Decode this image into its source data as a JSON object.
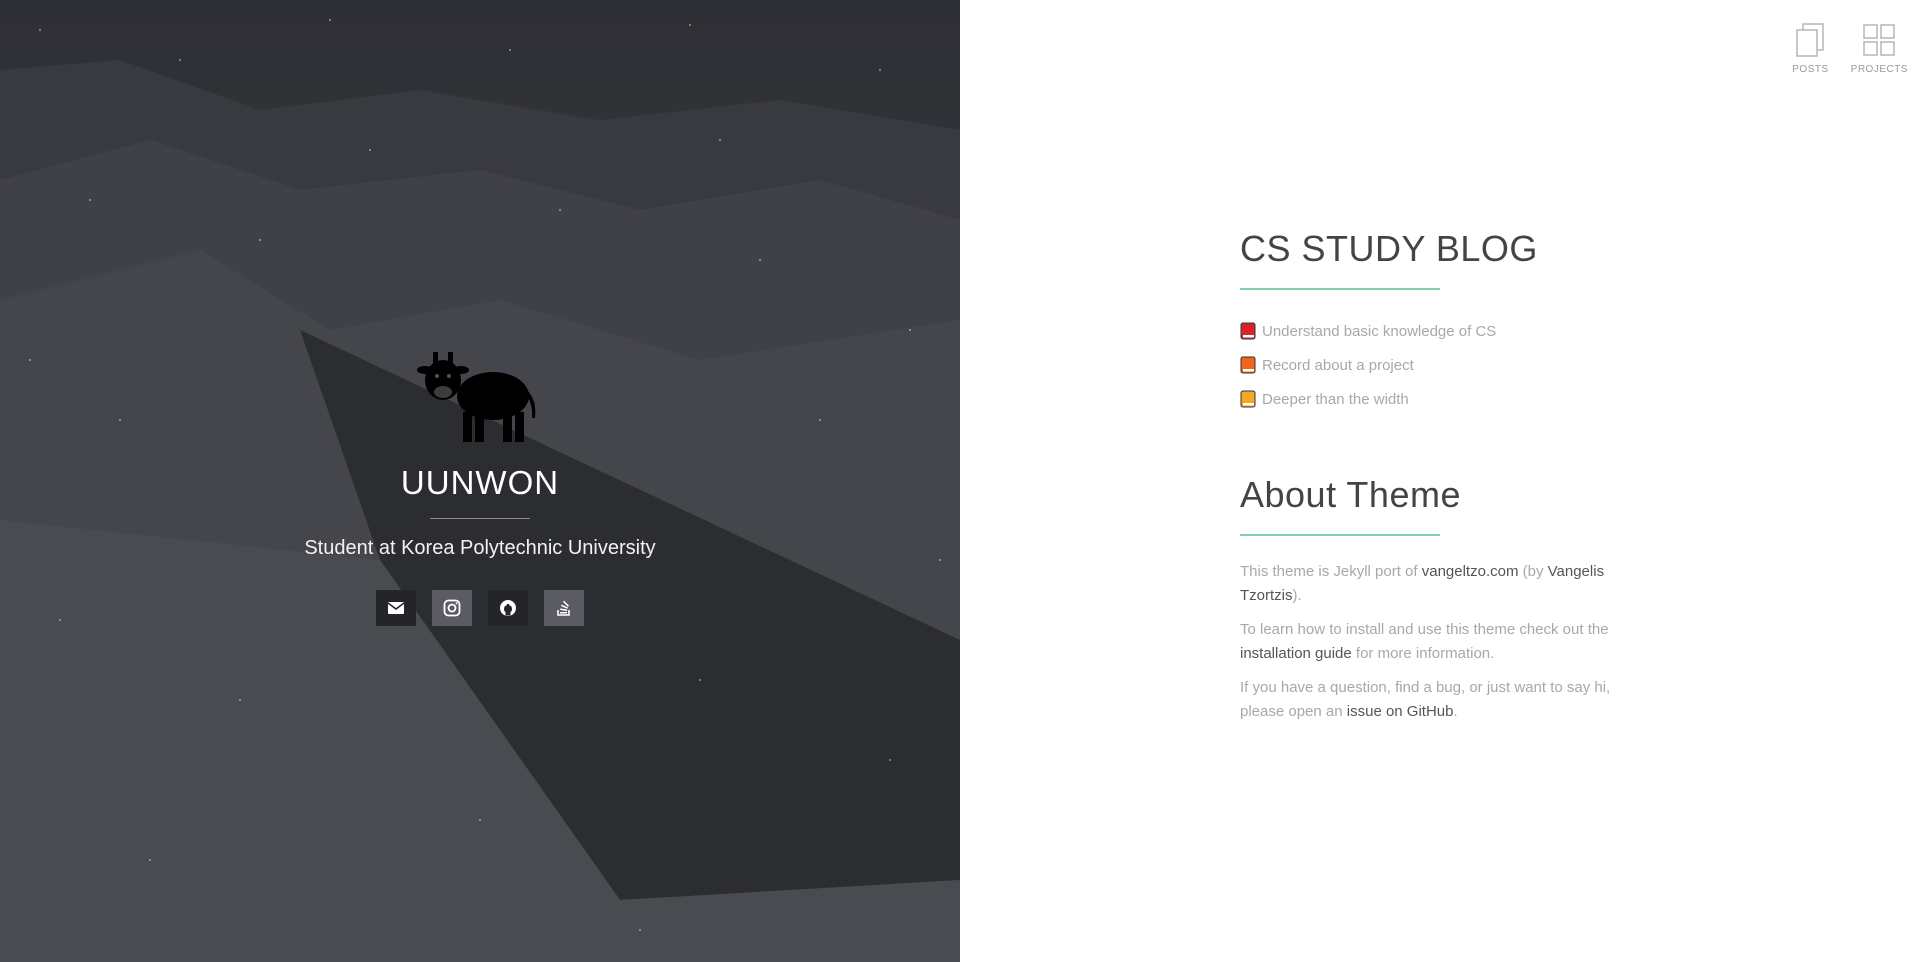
{
  "profile": {
    "name": "UUNWON",
    "subtitle": "Student at Korea Polytechnic University",
    "avatar_icon": "cow-icon",
    "social": [
      {
        "icon": "envelope-icon",
        "style": "dark"
      },
      {
        "icon": "instagram-icon",
        "style": "light"
      },
      {
        "icon": "github-icon",
        "style": "dark"
      },
      {
        "icon": "stackoverflow-icon",
        "style": "light"
      }
    ]
  },
  "nav": {
    "posts_label": "POSTS",
    "projects_label": "PROJECTS"
  },
  "blog": {
    "title": "CS STUDY BLOG",
    "goals": [
      {
        "text": "Understand basic knowledge of CS",
        "color": "#d8232a"
      },
      {
        "text": "Record about a project",
        "color": "#f0641e"
      },
      {
        "text": "Deeper than the width",
        "color": "#f5a623"
      }
    ]
  },
  "about": {
    "title": "About Theme",
    "p1_pre": "This theme is Jekyll port of ",
    "p1_link1": "vangeltzo.com",
    "p1_mid": " (by ",
    "p1_link2": "Vangelis Tzortzis",
    "p1_post": ").",
    "p2_pre": "To learn how to install and use this theme check out the ",
    "p2_link": "installation guide",
    "p2_post": " for more information.",
    "p3_pre": "If you have a question, find a bug, or just want to say hi, please open an ",
    "p3_link": "issue on GitHub",
    "p3_post": "."
  },
  "colors": {
    "accent_rule": "#7fd3a8",
    "left_bg": "#3a3b40"
  }
}
